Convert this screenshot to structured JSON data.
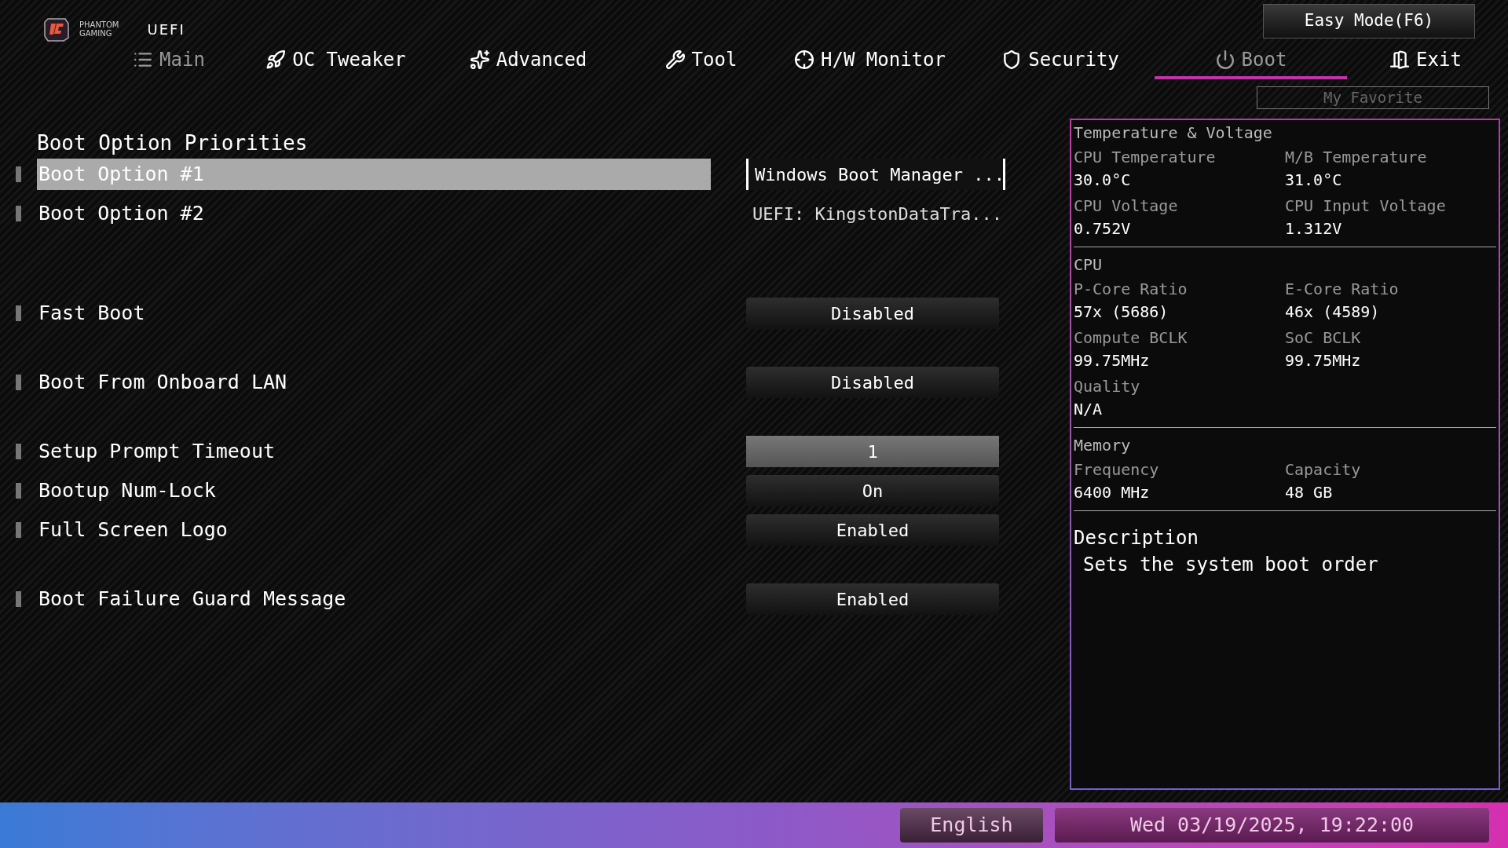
{
  "header": {
    "brand_line_1": "PHANTOM",
    "brand_line_2": "GAMING",
    "product": "UEFI",
    "easy_mode_button": "Easy Mode(F6)",
    "favorite_button": "My Favorite"
  },
  "tabs": [
    {
      "label": "Main",
      "selected": false,
      "dimmed": true
    },
    {
      "label": "OC Tweaker",
      "selected": false,
      "dimmed": false
    },
    {
      "label": "Advanced",
      "selected": false,
      "dimmed": false
    },
    {
      "label": "Tool",
      "selected": false,
      "dimmed": false
    },
    {
      "label": "H/W Monitor",
      "selected": false,
      "dimmed": false
    },
    {
      "label": "Security",
      "selected": false,
      "dimmed": false
    },
    {
      "label": "Boot",
      "selected": true,
      "dimmed": true
    },
    {
      "label": "Exit",
      "selected": false,
      "dimmed": false
    }
  ],
  "settings": {
    "heading": "Boot Option Priorities",
    "groups": [
      [
        {
          "label": "Boot Option #1",
          "value": "Windows Boot Manager ...",
          "kind": "plain",
          "selected": true
        },
        {
          "label": "Boot Option #2",
          "value": "UEFI: KingstonDataTra...",
          "kind": "plain",
          "selected": false
        }
      ],
      [
        {
          "label": "Fast Boot",
          "value": "Disabled",
          "kind": "button",
          "selected": false
        }
      ],
      [
        {
          "label": "Boot From Onboard LAN",
          "value": "Disabled",
          "kind": "button",
          "selected": false
        }
      ],
      [
        {
          "label": "Setup Prompt Timeout",
          "value": "1",
          "kind": "number",
          "selected": false
        },
        {
          "label": "Bootup Num-Lock",
          "value": "On",
          "kind": "button",
          "selected": false
        },
        {
          "label": "Full Screen Logo",
          "value": "Enabled",
          "kind": "button",
          "selected": false
        }
      ],
      [
        {
          "label": "Boot Failure Guard Message",
          "value": "Enabled",
          "kind": "button",
          "selected": false
        }
      ]
    ]
  },
  "info_panel": {
    "sections": [
      {
        "title": "Temperature & Voltage",
        "fields": [
          {
            "label": "CPU Temperature",
            "value": "30.0°C"
          },
          {
            "label": "M/B Temperature",
            "value": "31.0°C"
          },
          {
            "label": "CPU Voltage",
            "value": "0.752V"
          },
          {
            "label": "CPU Input Voltage",
            "value": "1.312V"
          }
        ]
      },
      {
        "title": "CPU",
        "fields": [
          {
            "label": "P-Core Ratio",
            "value": "57x (5686)"
          },
          {
            "label": "E-Core Ratio",
            "value": "46x (4589)"
          },
          {
            "label": "Compute BCLK",
            "value": "99.75MHz"
          },
          {
            "label": "SoC BCLK",
            "value": "99.75MHz"
          },
          {
            "label": "Quality",
            "value": "N/A"
          }
        ]
      },
      {
        "title": "Memory",
        "fields": [
          {
            "label": "Frequency",
            "value": "6400 MHz"
          },
          {
            "label": "Capacity",
            "value": "48 GB"
          }
        ]
      }
    ],
    "description_title": "Description",
    "description": "Sets the system boot order"
  },
  "status_bar": {
    "language": "English",
    "datetime": "Wed 03/19/2025, 19:22:00"
  }
}
